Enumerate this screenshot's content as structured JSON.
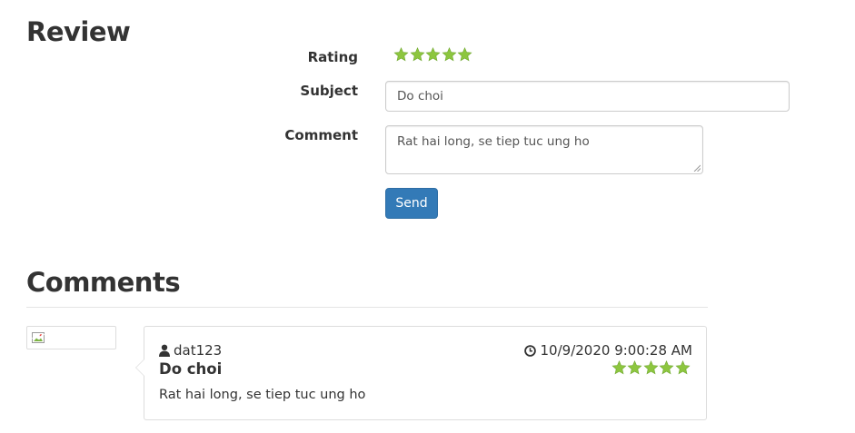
{
  "review": {
    "title": "Review",
    "rating_label": "Rating",
    "rating_value": 5,
    "rating_max": 5,
    "subject_label": "Subject",
    "subject_value": "Do choi",
    "comment_label": "Comment",
    "comment_value": "Rat hai long, se tiep tuc ung ho",
    "send_label": "Send"
  },
  "comments": {
    "title": "Comments",
    "items": [
      {
        "user": "dat123",
        "date": "10/9/2020 9:00:28 AM",
        "subject": "Do choi",
        "rating": 5,
        "body": "Rat hai long, se tiep tuc ung ho"
      }
    ]
  },
  "colors": {
    "star": "#8dc63f",
    "button": "#337ab7",
    "text": "#333333",
    "border": "#dddddd"
  },
  "icons": {
    "star": "star-icon",
    "user": "user-icon",
    "clock": "clock-icon",
    "broken_image": "broken-image-icon"
  }
}
